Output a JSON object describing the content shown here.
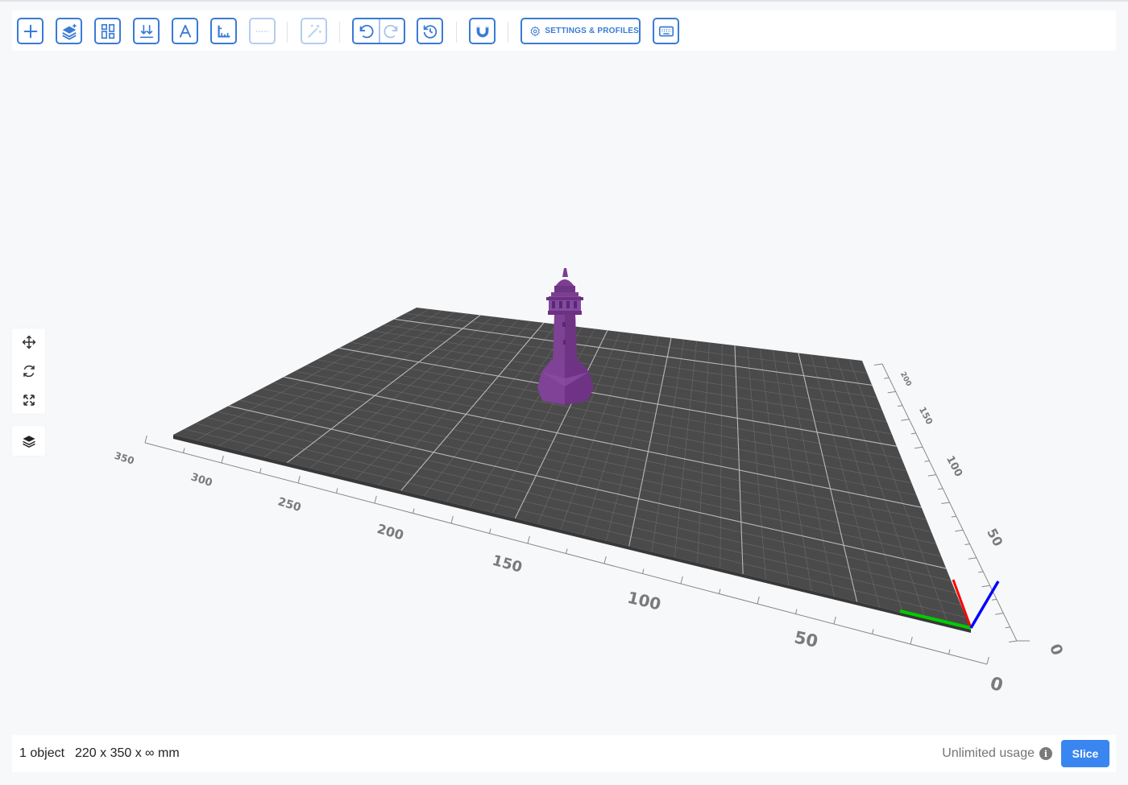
{
  "toolbar": {
    "buttons": [
      {
        "name": "add-object",
        "icon": "plus-icon"
      },
      {
        "name": "add-layer",
        "icon": "layers-plus-icon"
      },
      {
        "name": "arrange",
        "icon": "grid-icon"
      },
      {
        "name": "drop-to-bed",
        "icon": "drop-down-icon"
      },
      {
        "name": "add-text",
        "icon": "text-a-icon"
      },
      {
        "name": "measure",
        "icon": "ruler-icon"
      },
      {
        "name": "cut",
        "icon": "dotted-line-icon"
      },
      {
        "name": "auto-fix",
        "icon": "magic-wand-icon"
      },
      {
        "name": "undo",
        "icon": "undo-icon"
      },
      {
        "name": "redo",
        "icon": "redo-icon"
      },
      {
        "name": "history",
        "icon": "history-icon"
      },
      {
        "name": "snap",
        "icon": "magnet-icon"
      },
      {
        "name": "keyboard-shortcuts",
        "icon": "keyboard-icon"
      }
    ],
    "settings_label": "SETTINGS & PROFILES"
  },
  "side_tools": [
    "move-icon",
    "rotate-icon",
    "scale-icon",
    "layers-icon"
  ],
  "viewport": {
    "x_axis_labels": [
      "350",
      "300",
      "250",
      "200",
      "150",
      "100",
      "50",
      "0"
    ],
    "y_axis_labels": [
      "200",
      "150",
      "100",
      "50",
      "0"
    ],
    "model_color": "#7b3e91",
    "bed_color": "#4a4a4a",
    "axis_colors": {
      "x": "#ff0000",
      "y": "#00cc00",
      "z": "#0000ff"
    }
  },
  "status": {
    "object_count": "1 object",
    "dimensions": "220 x 350 x ∞ mm",
    "usage": "Unlimited usage",
    "slice_label": "Slice"
  },
  "colors": {
    "accent": "#3a7bd5",
    "slice": "#3a86f0"
  }
}
